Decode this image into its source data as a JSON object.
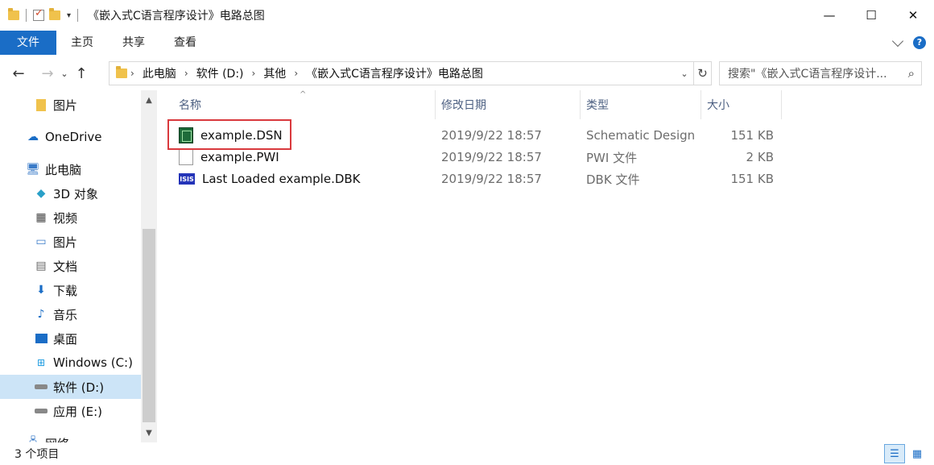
{
  "window": {
    "title": "《嵌入式C语言程序设计》电路总图",
    "minimize_glyph": "—",
    "maximize_glyph": "☐",
    "close_glyph": "✕"
  },
  "ribbon": {
    "tabs": [
      "文件",
      "主页",
      "共享",
      "查看"
    ]
  },
  "nav": {
    "back_glyph": "←",
    "forward_glyph": "→",
    "recent_glyph": "⌄",
    "up_glyph": "↑"
  },
  "address": {
    "crumbs": [
      "此电脑",
      "软件 (D:)",
      "其他",
      "《嵌入式C语言程序设计》电路总图"
    ],
    "separator": "›",
    "dropdown_glyph": "⌄",
    "refresh_glyph": "↻"
  },
  "search": {
    "placeholder": "搜索\"《嵌入式C语言程序设计...",
    "icon": "search-icon",
    "icon_glyph": "⌕"
  },
  "sidebar": {
    "items": [
      {
        "label": "图片",
        "icon": "folder-icon"
      },
      {
        "label": "OneDrive",
        "icon": "cloud-icon"
      },
      {
        "label": "此电脑",
        "icon": "computer-icon"
      },
      {
        "label": "3D 对象",
        "icon": "cube-icon"
      },
      {
        "label": "视频",
        "icon": "film-icon"
      },
      {
        "label": "图片",
        "icon": "picture-icon"
      },
      {
        "label": "文档",
        "icon": "document-icon"
      },
      {
        "label": "下载",
        "icon": "download-icon"
      },
      {
        "label": "音乐",
        "icon": "music-icon"
      },
      {
        "label": "桌面",
        "icon": "desktop-icon"
      },
      {
        "label": "Windows (C:)",
        "icon": "windows-drive-icon"
      },
      {
        "label": "软件 (D:)",
        "icon": "drive-icon",
        "selected": true
      },
      {
        "label": "应用 (E:)",
        "icon": "drive-icon"
      },
      {
        "label": "网络",
        "icon": "network-icon"
      }
    ],
    "scroll_up_glyph": "▲",
    "scroll_down_glyph": "▼"
  },
  "filelist": {
    "columns": [
      "名称",
      "修改日期",
      "类型",
      "大小"
    ],
    "sort_glyph": "^",
    "rows": [
      {
        "name": "example.DSN",
        "date": "2019/9/22 18:57",
        "type": "Schematic Design",
        "size": "151 KB",
        "icon": "dsn-file-icon"
      },
      {
        "name": "example.PWI",
        "date": "2019/9/22 18:57",
        "type": "PWI 文件",
        "size": "2 KB",
        "icon": "blank-file-icon"
      },
      {
        "name": "Last Loaded example.DBK",
        "date": "2019/9/22 18:57",
        "type": "DBK 文件",
        "size": "151 KB",
        "icon": "isis-file-icon"
      }
    ],
    "highlight_color": "#d9393d",
    "dbk_icon_text": "ISIS"
  },
  "status": {
    "item_count": "3 个项目",
    "details_glyph": "☰",
    "tiles_glyph": "▦"
  },
  "colors": {
    "accent": "#1a6dc6",
    "selection": "#cce4f7"
  }
}
